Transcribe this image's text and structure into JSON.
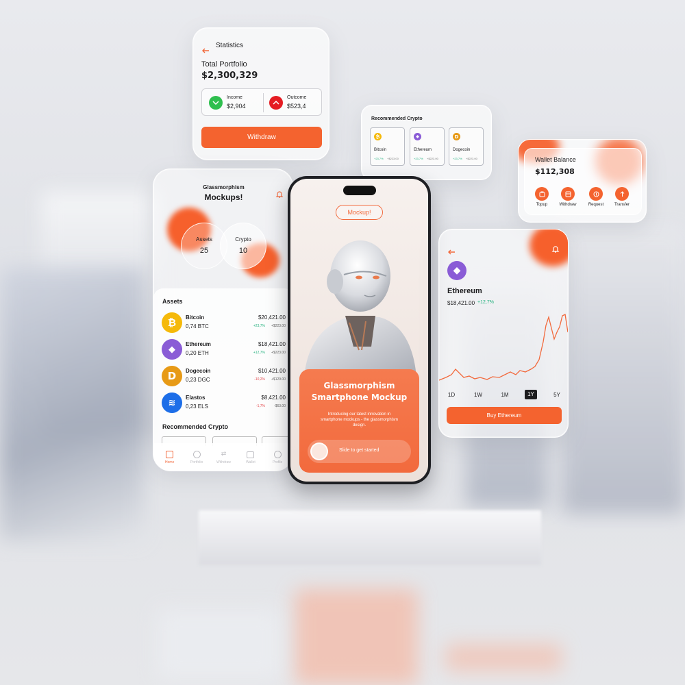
{
  "statistics": {
    "title": "Statistics",
    "total_label": "Total Portfolio",
    "total_value": "$2,300,329",
    "income_label": "Income",
    "income_value": "$2,904",
    "outcome_label": "Outcome",
    "outcome_value": "$523,4",
    "withdraw_label": "Withdraw"
  },
  "recommended": {
    "title": "Recommended Crypto",
    "items": [
      {
        "name": "Bitcoin",
        "change": "+23,7%",
        "value": "+$223.00"
      },
      {
        "name": "Ethereum",
        "change": "+23,7%",
        "value": "+$223.00"
      },
      {
        "name": "Dogecoin",
        "change": "+23,7%",
        "value": "+$223.00"
      }
    ]
  },
  "wallet": {
    "title": "Wallet Balance",
    "value": "$112,308",
    "actions": [
      "Topup",
      "Withdraw",
      "Request",
      "Transfer"
    ]
  },
  "left_phone": {
    "title_line1": "Glassmorphism",
    "title_line2": "Mockups!",
    "assets_circle_label": "Assets",
    "assets_circle_value": "25",
    "crypto_circle_label": "Crypto",
    "crypto_circle_value": "10",
    "assets_heading": "Assets",
    "assets": [
      {
        "name": "Bitcoin",
        "amount": "0,74 BTC",
        "price": "$20,421.00",
        "change": "+23,7%",
        "delta": "+$223.00",
        "dir": "up"
      },
      {
        "name": "Ethereum",
        "amount": "0,20 ETH",
        "price": "$18,421.00",
        "change": "+12,7%",
        "delta": "+$223.00",
        "dir": "up"
      },
      {
        "name": "Dogecoin",
        "amount": "0,23 DGC",
        "price": "$10,421.00",
        "change": "-10,2%",
        "delta": "+$129.00",
        "dir": "down"
      },
      {
        "name": "Elastos",
        "amount": "0,23 ELS",
        "price": "$8,421.00",
        "change": "-1,7%",
        "delta": "-$63.00",
        "dir": "down"
      }
    ],
    "recommended_heading": "Recommended Crypto",
    "nav": [
      "Home",
      "Portfolio",
      "Withdraw",
      "Wallet",
      "Profile"
    ]
  },
  "center_phone": {
    "badge": "Mockup!",
    "card_title_line1": "Glassmorphism",
    "card_title_line2": "Smartphone Mockup",
    "card_desc": "Introducing our latest innovation in smartphone mockups - the glassmorphism design.",
    "slide_label": "Slide to get started"
  },
  "eth_card": {
    "name": "Ethereum",
    "price": "$18,421.00",
    "change": "+12,7%",
    "ranges": [
      "1D",
      "1W",
      "1M",
      "1Y",
      "5Y"
    ],
    "active_range": "1Y",
    "buy_label": "Buy Ethereum"
  },
  "colors": {
    "accent": "#f4632f",
    "green": "#22b07d",
    "red": "#e2464b"
  }
}
